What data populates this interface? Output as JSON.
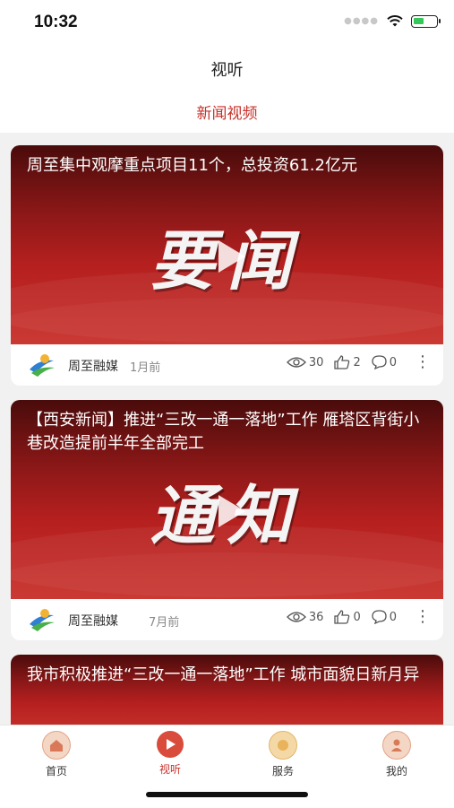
{
  "status_bar": {
    "time": "10:32"
  },
  "header": {
    "title": "视听",
    "active_tab": "新闻视频"
  },
  "feed": {
    "cards": [
      {
        "title": "周至集中观摩重点项目11个，总投资61.2亿元",
        "thumb_text": "要闻",
        "source": "周至融媒",
        "time_ago": "1月前",
        "views": "30",
        "likes": "2",
        "comments": "0"
      },
      {
        "title": "【西安新闻】推进“三改一通一落地”工作 雁塔区背街小巷改造提前半年全部完工",
        "thumb_text": "通知",
        "source": "周至融媒",
        "time_ago": "7月前",
        "views": "36",
        "likes": "0",
        "comments": "0"
      },
      {
        "title": "我市积极推进“三改一通一落地”工作 城市面貌日新月异"
      }
    ]
  },
  "tabbar": {
    "items": [
      {
        "label": "首页",
        "icon": "home-icon"
      },
      {
        "label": "视听",
        "icon": "video-icon",
        "active": true
      },
      {
        "label": "服务",
        "icon": "service-icon"
      },
      {
        "label": "我的",
        "icon": "profile-icon"
      }
    ]
  },
  "colors": {
    "accent": "#c8312a",
    "thumb_red": "#b5201f"
  }
}
